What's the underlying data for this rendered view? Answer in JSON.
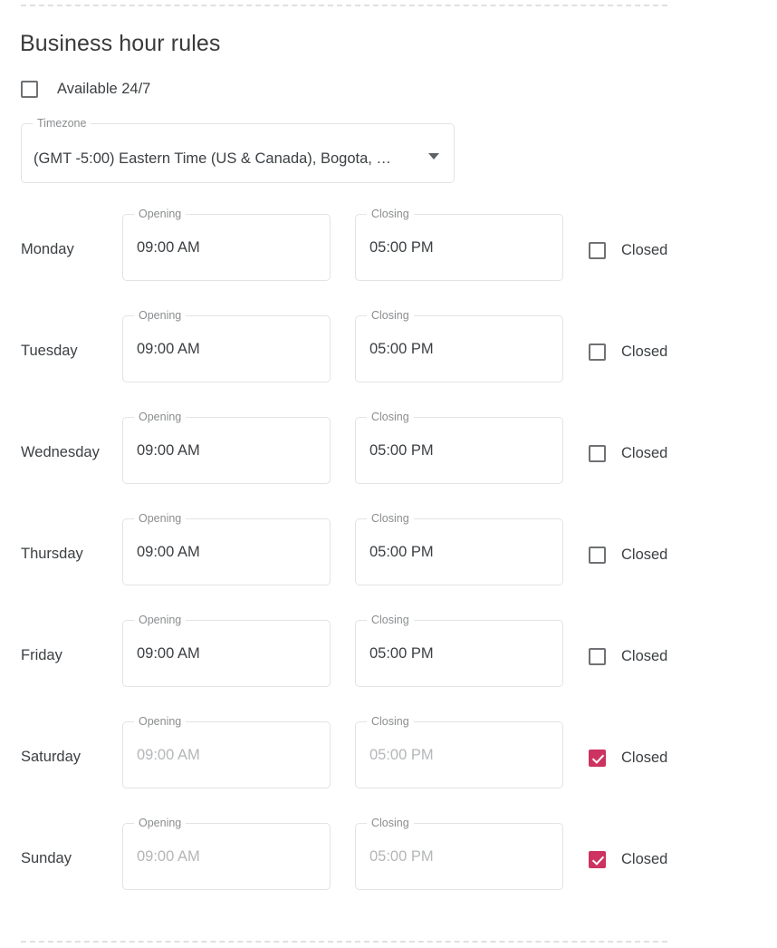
{
  "section": {
    "title": "Business hour rules"
  },
  "available_247": {
    "label": "Available 24/7",
    "checked": false
  },
  "timezone": {
    "legend": "Timezone",
    "value": "(GMT -5:00) Eastern Time (US & Canada), Bogota, …",
    "arrow_icon": "chevron-down-icon"
  },
  "column_labels": {
    "opening": "Opening",
    "closing": "Closing",
    "closed": "Closed"
  },
  "colors": {
    "accent_checked": "#cd3360",
    "checkbox_border": "#6f7174",
    "field_border": "#e2e3e4",
    "disabled_text": "#b4b6b8",
    "divider": "#dfe0e1"
  },
  "days": [
    {
      "name": "Monday",
      "opening_legend": "Opening",
      "opening_value": "09:00 AM",
      "closing_legend": "Closing",
      "closing_value": "05:00 PM",
      "closed_label": "Closed",
      "closed": false,
      "disabled": false
    },
    {
      "name": "Tuesday",
      "opening_legend": "Opening",
      "opening_value": "09:00 AM",
      "closing_legend": "Closing",
      "closing_value": "05:00 PM",
      "closed_label": "Closed",
      "closed": false,
      "disabled": false
    },
    {
      "name": "Wednesday",
      "opening_legend": "Opening",
      "opening_value": "09:00 AM",
      "closing_legend": "Closing",
      "closing_value": "05:00 PM",
      "closed_label": "Closed",
      "closed": false,
      "disabled": false
    },
    {
      "name": "Thursday",
      "opening_legend": "Opening",
      "opening_value": "09:00 AM",
      "closing_legend": "Closing",
      "closing_value": "05:00 PM",
      "closed_label": "Closed",
      "closed": false,
      "disabled": false
    },
    {
      "name": "Friday",
      "opening_legend": "Opening",
      "opening_value": "09:00 AM",
      "closing_legend": "Closing",
      "closing_value": "05:00 PM",
      "closed_label": "Closed",
      "closed": false,
      "disabled": false
    },
    {
      "name": "Saturday",
      "opening_legend": "Opening",
      "opening_value": "09:00 AM",
      "closing_legend": "Closing",
      "closing_value": "05:00 PM",
      "closed_label": "Closed",
      "closed": true,
      "disabled": true
    },
    {
      "name": "Sunday",
      "opening_legend": "Opening",
      "opening_value": "09:00 AM",
      "closing_legend": "Closing",
      "closing_value": "05:00 PM",
      "closed_label": "Closed",
      "closed": true,
      "disabled": true
    }
  ]
}
